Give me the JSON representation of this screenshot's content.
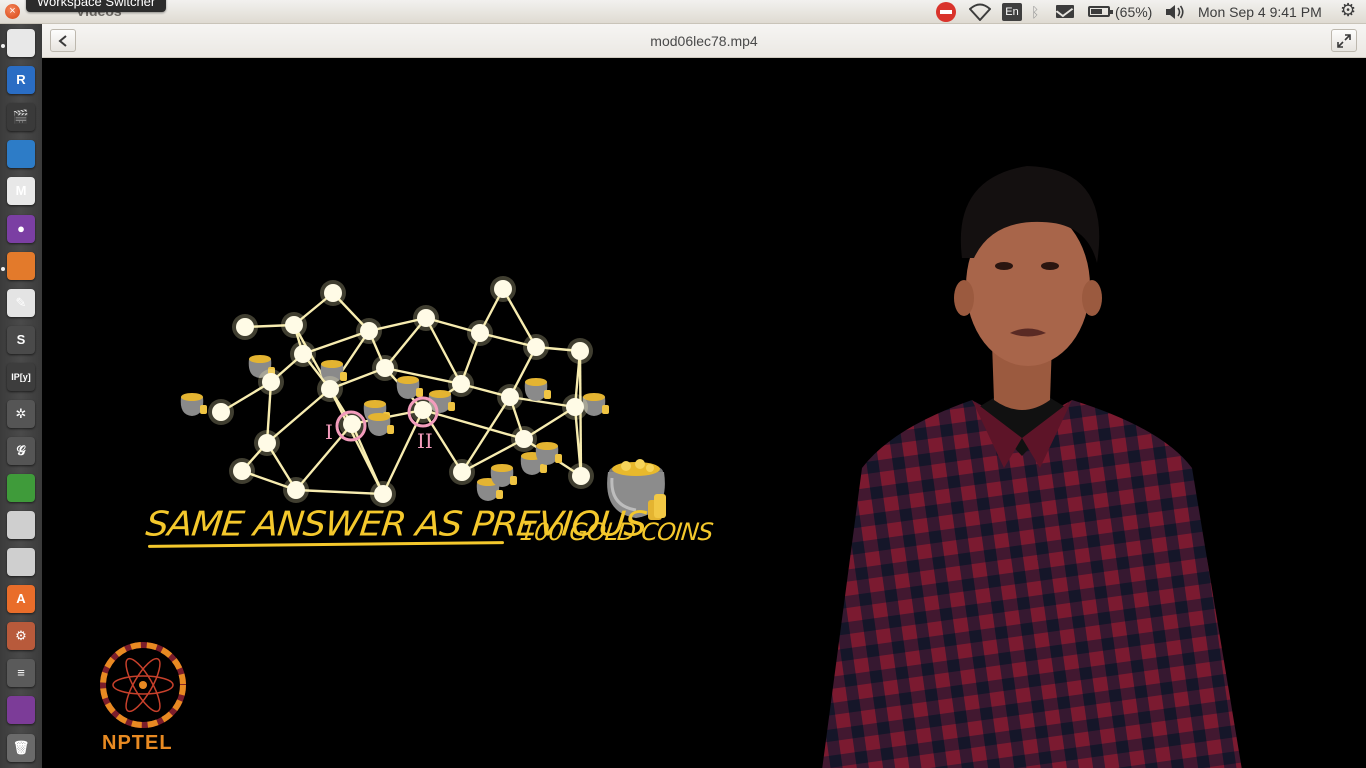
{
  "top_panel": {
    "app_name": "Videos",
    "tooltip": "Workspace Switcher",
    "close_glyph": "×",
    "lang_indicator": "En",
    "battery_text": "(65%)",
    "clock": "Mon Sep  4  9:41 PM",
    "wifi_glyph": "◠",
    "bluetooth_glyph": "ᛒ",
    "volume_glyph": "🔊",
    "gear_glyph": "⚙"
  },
  "launcher": {
    "items": [
      {
        "name": "evince-icon",
        "glyph": "",
        "color": "#e8e8e8"
      },
      {
        "name": "r-icon",
        "glyph": "R",
        "color": "#2a6dc4"
      },
      {
        "name": "video-player-icon",
        "glyph": "🎬",
        "color": "#3a3a3a"
      },
      {
        "name": "writer-document-icon",
        "glyph": "",
        "color": "#2d7cc7"
      },
      {
        "name": "gmail-icon",
        "glyph": "M",
        "color": "#e8e8e8"
      },
      {
        "name": "screencast-icon",
        "glyph": "●",
        "color": "#7b3fa3"
      },
      {
        "name": "impress-icon",
        "glyph": "",
        "color": "#e37a2b"
      },
      {
        "name": "text-editor-icon",
        "glyph": "✎",
        "color": "#e4e4e4"
      },
      {
        "name": "sublime-text-icon",
        "glyph": "S",
        "color": "#4a4a4a"
      },
      {
        "name": "ipython-icon",
        "glyph": "IP[y]",
        "color": "#3d3d3d"
      },
      {
        "name": "settings-cog-icon",
        "glyph": "✲",
        "color": "#555"
      },
      {
        "name": "geogebra-icon",
        "glyph": "𝒢",
        "color": "#555"
      },
      {
        "name": "calc-spreadsheet-icon",
        "glyph": "",
        "color": "#3f9b3a"
      },
      {
        "name": "drive-icon",
        "glyph": "",
        "color": "#cfcfcf"
      },
      {
        "name": "drive2-icon",
        "glyph": "",
        "color": "#cfcfcf"
      },
      {
        "name": "software-center-icon",
        "glyph": "A",
        "color": "#e96d2a"
      },
      {
        "name": "system-settings-icon",
        "glyph": "⚙",
        "color": "#b85a3b"
      },
      {
        "name": "terminal-icon",
        "glyph": "≡",
        "color": "#5a5a5a"
      },
      {
        "name": "workspace-switcher-icon",
        "glyph": "",
        "color": "#7c3c98"
      },
      {
        "name": "trash-icon",
        "glyph": "🗑",
        "color": "#6a6a6a"
      }
    ]
  },
  "video": {
    "title": "mod06lec78.mp4",
    "caption_left": "SAME ANSWER AS PREVIOUS",
    "caption_right": "100 GOLD COINS",
    "label_one": "I",
    "label_two": "II",
    "logo_text": "NPTEL"
  },
  "colors": {
    "caption": "#f4c82c",
    "node": "#fffbe6",
    "edge": "#f7ecb0",
    "marker": "#f39cbc",
    "shirt_red": "#7b1a30",
    "shirt_blue": "#1b1c3a"
  }
}
